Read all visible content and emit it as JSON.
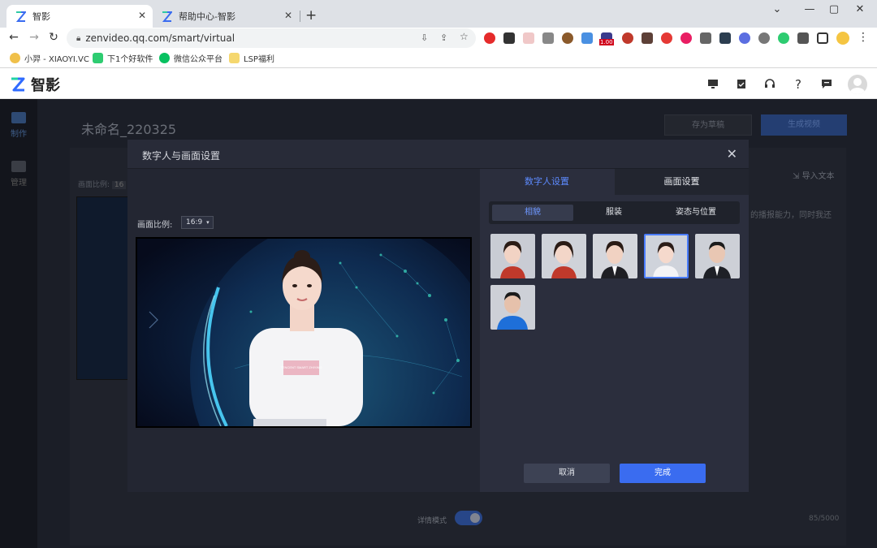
{
  "browser": {
    "tabs": [
      {
        "title": "智影"
      },
      {
        "title": "帮助中心-智影"
      }
    ],
    "url": "zenvideo.qq.com/smart/virtual",
    "bookmarks": [
      {
        "label": "小羿 - XIAOYI.VC"
      },
      {
        "label": "下1个好软件"
      },
      {
        "label": "微信公众平台"
      },
      {
        "label": "LSP福利"
      }
    ],
    "extension_badge": "1.00"
  },
  "app": {
    "logo_text": "智影",
    "sidebar": [
      {
        "label": "制作"
      },
      {
        "label": "管理"
      }
    ],
    "doc_title": "未命名_220325",
    "save_draft": "存为草稿",
    "generate_video": "生成视频",
    "ratio_label_bg": "画面比例:",
    "ratio_value_bg": "16",
    "import_text": "导入文本",
    "script_text": "的播报能力，同时我还",
    "mode_label": "详情模式",
    "char_count": "85/5000"
  },
  "modal": {
    "title": "数字人与画面设置",
    "ratio_label": "画面比例:",
    "ratio_value": "16:9",
    "tabs": [
      {
        "label": "数字人设置"
      },
      {
        "label": "画面设置"
      }
    ],
    "subtabs": [
      {
        "label": "相貌"
      },
      {
        "label": "服装"
      },
      {
        "label": "姿态与位置"
      }
    ],
    "shirt_text": "TENCENT SMART ZHIYING",
    "cancel": "取消",
    "done": "完成"
  },
  "colors": {
    "accent": "#3a6cf0",
    "active_tab": "#5d8bff",
    "modal_bg": "#232632",
    "panel_bg": "#2b2e3d"
  }
}
